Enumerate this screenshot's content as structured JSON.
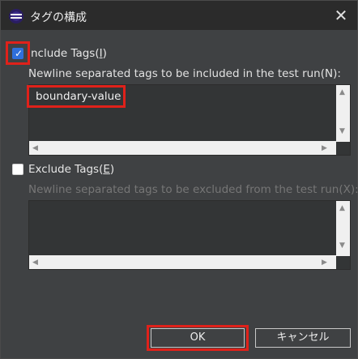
{
  "window": {
    "title": "タグの構成",
    "close_glyph": "✕"
  },
  "include": {
    "checkbox_checked": true,
    "label_prefix": "nclude Tags(",
    "label_mnemonic": "I",
    "label_suffix": ")",
    "hint": "Newline separated tags to be included in the test run(N):",
    "value": "boundary-value"
  },
  "exclude": {
    "checkbox_checked": false,
    "label_prefix": "Exclude Tags(",
    "label_mnemonic": "E",
    "label_suffix": ")",
    "hint": "Newline separated tags to be excluded from the test run(X):",
    "value": ""
  },
  "buttons": {
    "ok": "OK",
    "cancel": "キャンセル"
  },
  "icons": {
    "app": "eclipse-icon",
    "close": "close-icon",
    "check": "checkmark-icon",
    "scroll_up": "arrow-up-icon",
    "scroll_down": "arrow-down-icon",
    "scroll_left": "arrow-left-icon",
    "scroll_right": "arrow-right-icon"
  },
  "colors": {
    "highlight": "#e0211a",
    "checkbox_accent": "#2f6fdc",
    "dialog_bg": "#3f4143",
    "titlebar_bg": "#2b2b2b"
  }
}
